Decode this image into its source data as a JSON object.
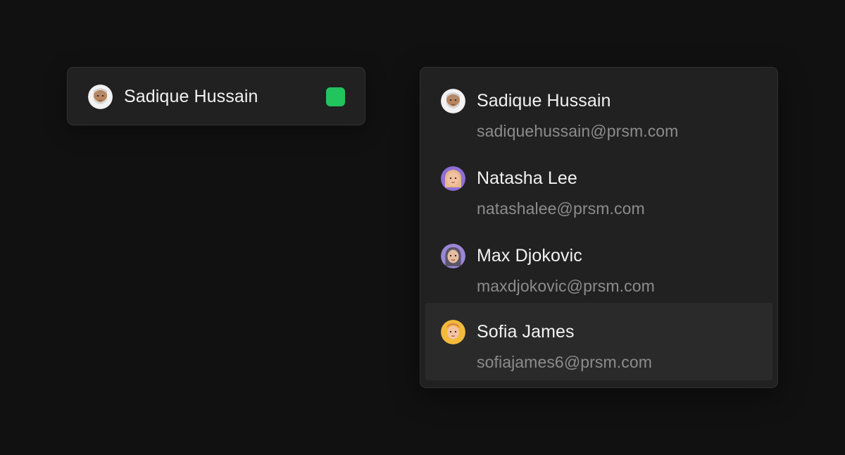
{
  "selector": {
    "selected_name": "Sadique Hussain",
    "selected_avatar": "memoji-man-grey-beard-icon",
    "status_color": "#21c45d"
  },
  "menu": {
    "options": [
      {
        "name": "Sadique Hussain",
        "email": "sadiquehussain@prsm.com",
        "avatar": "memoji-man-grey-beard-icon",
        "avatar_bg": "#f2f2f2"
      },
      {
        "name": "Natasha Lee",
        "email": "natashalee@prsm.com",
        "avatar": "memoji-woman-blonde-icon",
        "avatar_bg": "#8f6fd6"
      },
      {
        "name": "Max Djokovic",
        "email": "maxdjokovic@prsm.com",
        "avatar": "memoji-woman-grey-hair-icon",
        "avatar_bg": "#9b86d8"
      },
      {
        "name": "Sofia James",
        "email": "sofiajames6@prsm.com",
        "avatar": "memoji-woman-ginger-icon",
        "avatar_bg": "#f2b93b",
        "highlighted": true
      }
    ]
  },
  "colors": {
    "page_bg": "#111111",
    "surface": "#212121",
    "border": "#303030",
    "highlight": "#2a2a2a",
    "text_primary": "#f2f2f2",
    "text_secondary": "#8c8c8c",
    "status_green": "#21c45d"
  }
}
